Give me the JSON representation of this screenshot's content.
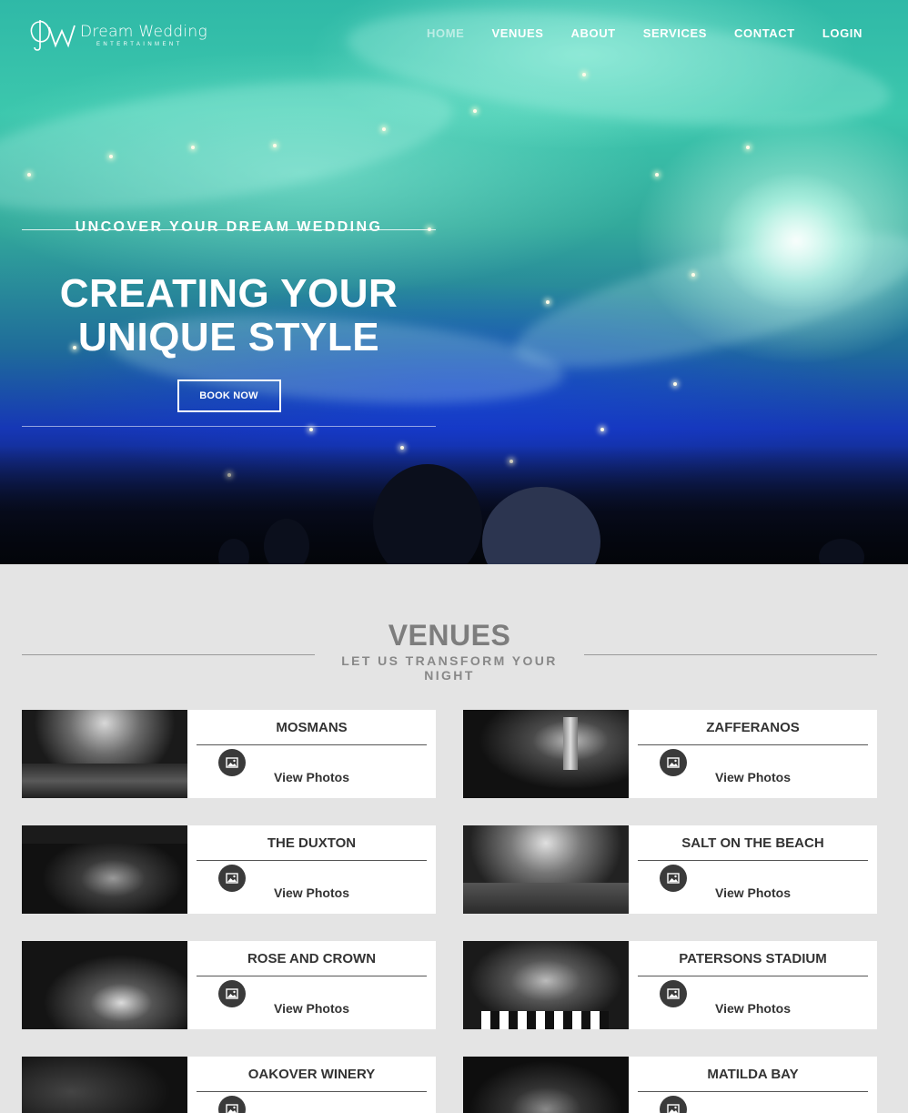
{
  "brand": {
    "name": "Dream Wedding",
    "tagline": "ENTERTAINMENT"
  },
  "nav": [
    {
      "label": "HOME",
      "active": true
    },
    {
      "label": "VENUES",
      "active": false
    },
    {
      "label": "ABOUT",
      "active": false
    },
    {
      "label": "SERVICES",
      "active": false
    },
    {
      "label": "CONTACT",
      "active": false
    },
    {
      "label": "LOGIN",
      "active": false
    }
  ],
  "hero": {
    "eyebrow": "UNCOVER YOUR DREAM WEDDING",
    "title_line1": "CREATING YOUR",
    "title_line2": "UNIQUE STYLE",
    "cta": "BOOK NOW"
  },
  "venues": {
    "title": "VENUES",
    "subtitle": "LET US TRANSFORM YOUR NIGHT",
    "action_label": "View Photos",
    "action_icon": "photo-icon",
    "items": [
      {
        "name": "MOSMANS"
      },
      {
        "name": "ZAFFERANOS"
      },
      {
        "name": "THE DUXTON"
      },
      {
        "name": "SALT ON THE BEACH"
      },
      {
        "name": "ROSE AND CROWN"
      },
      {
        "name": "PATERSONS STADIUM"
      },
      {
        "name": "OAKOVER WINERY"
      },
      {
        "name": "MATILDA BAY"
      }
    ]
  }
}
